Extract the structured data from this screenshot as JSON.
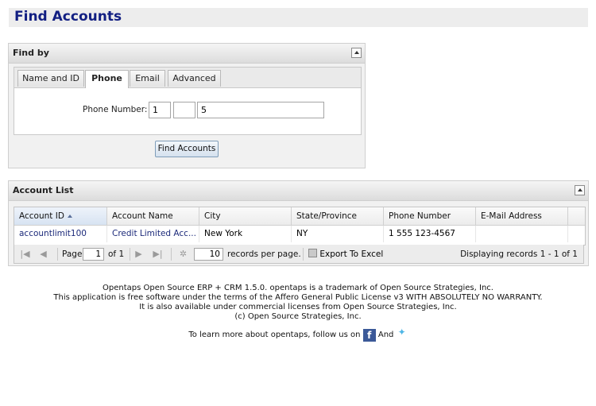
{
  "page": {
    "title": "Find Accounts"
  },
  "find_by": {
    "title": "Find by",
    "tabs": [
      {
        "label": "Name and ID"
      },
      {
        "label": "Phone"
      },
      {
        "label": "Email"
      },
      {
        "label": "Advanced"
      }
    ],
    "active_tab": "Phone",
    "phone_label": "Phone Number:",
    "phone_country": "1",
    "phone_area": "",
    "phone_number": "5",
    "submit_label": "Find Accounts"
  },
  "account_list": {
    "title": "Account List",
    "columns": [
      "Account ID",
      "Account Name",
      "City",
      "State/Province",
      "Phone Number",
      "E-Mail Address"
    ],
    "rows": [
      {
        "id": "accountlimit100",
        "name": "Credit Limited Acc...",
        "city": "New York",
        "state": "NY",
        "phone": "1 555 123-4567",
        "email": ""
      }
    ],
    "pager": {
      "page_label": "Page",
      "page": "1",
      "of_label": "of 1",
      "page_size": "10",
      "per_page_label": "records per page.",
      "export_label": "Export To Excel",
      "display_text": "Displaying records 1 - 1 of 1"
    }
  },
  "footer": {
    "line1": "Opentaps Open Source ERP + CRM 1.5.0. opentaps is a trademark of Open Source Strategies, Inc.",
    "line2": "This application is free software under the terms of the Affero General Public License v3 WITH ABSOLUTELY NO WARRANTY.",
    "line3": "It is also available under commercial licenses from Open Source Strategies, Inc.",
    "line4": "(c) Open Source Strategies, Inc.",
    "follow_text": "To learn more about opentaps, follow us on",
    "and_text": "And"
  },
  "icons": {
    "facebook": "facebook-icon",
    "twitter": "twitter-icon",
    "collapse": "collapse-up-icon"
  }
}
